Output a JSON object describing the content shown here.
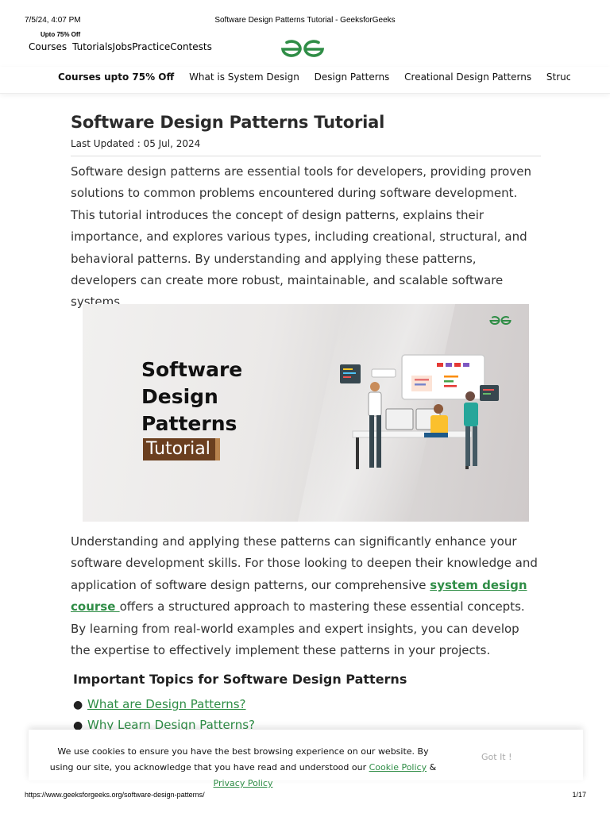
{
  "print_header": {
    "datetime": "7/5/24, 4:07 PM",
    "title": "Software Design Patterns Tutorial - GeeksforGeeks"
  },
  "topbar": {
    "promo": "Upto 75% Off",
    "nav": [
      "Courses",
      "Tutorials",
      "Jobs",
      "Practice",
      "Contests"
    ]
  },
  "subnav": {
    "items": [
      "Courses upto 75% Off",
      "What is System Design",
      "Design Patterns",
      "Creational Design Patterns",
      "Structural Design Pa"
    ]
  },
  "article": {
    "title": "Software Design Patterns Tutorial",
    "updated": "Last Updated : 05 Jul, 2024",
    "intro": "Software design patterns are essential tools for developers, providing proven solutions to common problems encountered during software development. This tutorial introduces the concept of design patterns, explains their importance, and explores various types, including creational, structural, and behavioral patterns. By understanding and applying these patterns, developers can create more robust, maintainable, and scalable software systems.",
    "banner": {
      "line1": "Software",
      "line2": "Design",
      "line3": "Patterns",
      "tag": "Tutorial"
    },
    "para2_before": "Understanding and applying these patterns can significantly enhance your software development skills. For those looking to deepen their knowledge and application of software design patterns, our comprehensive ",
    "para2_link": "system design course ",
    "para2_after": "offers a structured approach to mastering these essential concepts. By learning from real-world examples and expert insights, you can develop the expertise to effectively implement these patterns in your projects.",
    "topics_heading": "Important Topics for Software Design Patterns",
    "topics": [
      "What are Design Patterns?",
      "Why Learn Design Patterns?"
    ]
  },
  "cookie": {
    "text_before": "We use cookies to ensure you have the best browsing experience on our website. By using our site, you acknowledge that you have read and understood our ",
    "cookie_policy": "Cookie Policy",
    "amp": " & ",
    "privacy_policy": "Privacy Policy",
    "button": "Got It !"
  },
  "print_footer": {
    "url": "https://www.geeksforgeeks.org/software-design-patterns/",
    "page": "1/17"
  },
  "colors": {
    "brand_green": "#2f8d46",
    "tag_brown": "#6b3f1f"
  }
}
